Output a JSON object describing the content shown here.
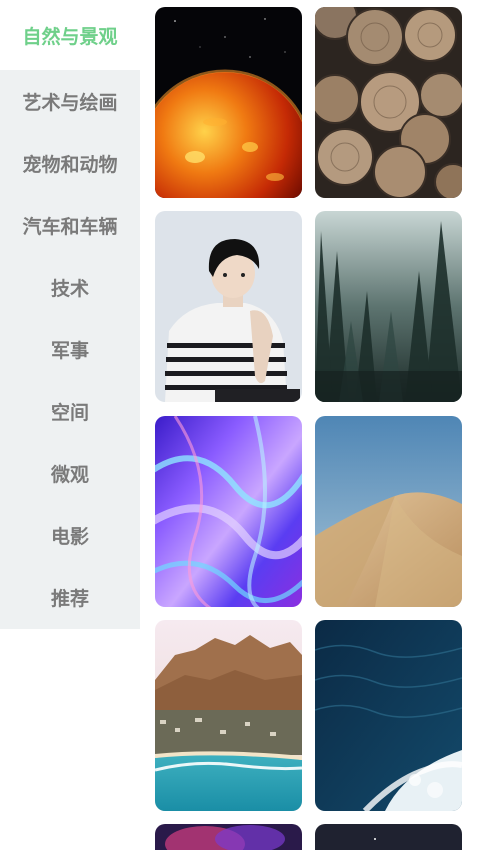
{
  "sidebar": {
    "items": [
      {
        "label": "自然与景观",
        "active": true
      },
      {
        "label": "艺术与绘画"
      },
      {
        "label": "宠物和动物"
      },
      {
        "label": "汽车和车辆"
      },
      {
        "label": "技术"
      },
      {
        "label": "军事"
      },
      {
        "label": "空间"
      },
      {
        "label": "微观"
      },
      {
        "label": "电影"
      },
      {
        "label": "推荐"
      }
    ]
  },
  "colors": {
    "accent": "#6fd08a",
    "sidebar_bg": "#eef1f2",
    "inactive_text": "#7a7a7a"
  },
  "wallpapers": [
    {
      "subject": "sun-in-space"
    },
    {
      "subject": "stacked-logs"
    },
    {
      "subject": "young-man-striped-sweater"
    },
    {
      "subject": "misty-forest"
    },
    {
      "subject": "holographic-abstract"
    },
    {
      "subject": "desert-dune"
    },
    {
      "subject": "coastal-mountains-beach"
    },
    {
      "subject": "ocean-waves"
    },
    {
      "subject": "purple-nebula"
    },
    {
      "subject": "night-sky"
    }
  ]
}
